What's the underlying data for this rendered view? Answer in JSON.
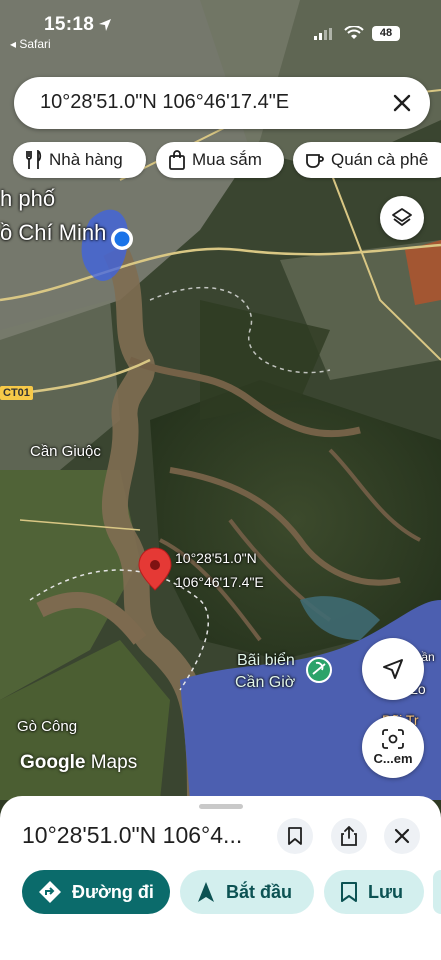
{
  "status_bar": {
    "time": "15:18",
    "back_app": "◂ Safari",
    "battery": "48"
  },
  "search": {
    "value": "10°28'51.0\"N 106°46'17.4\"E"
  },
  "chips": [
    {
      "label": "Nhà hàng",
      "icon": "utensils-icon"
    },
    {
      "label": "Mua sắm",
      "icon": "shopping-bag-icon"
    },
    {
      "label": "Quán cà phê",
      "icon": "coffee-icon"
    }
  ],
  "map": {
    "labels": {
      "city_line1": "h phố",
      "city_line2": "ồ Chí Minh",
      "can_giuoc": "Cần Giuộc",
      "go_cong": "Gò Công",
      "beach_line1": "Bãi biển",
      "beach_line2": "Cần Giờ",
      "east_a": "Gần",
      "east_b": "Bãi Tr",
      "east_c": "Bãi Lo",
      "road_badge": "CT01"
    },
    "pin_label_lat": "10°28'51.0\"N",
    "pin_label_lng": "106°46'17.4\"E",
    "lens_label": "C...em",
    "google_brand": "Google",
    "google_product": "Maps",
    "colors": {
      "pin": "#e53935",
      "water": "#4c5fb0",
      "location_dot": "#1a73e8"
    }
  },
  "sheet": {
    "title": "10°28'51.0\"N 106°4...",
    "actions": [
      {
        "label": "Đường đi",
        "icon": "directions-icon"
      },
      {
        "label": "Bắt đầu",
        "icon": "navigation-arrow-icon"
      },
      {
        "label": "Lưu",
        "icon": "bookmark-icon"
      }
    ],
    "colors": {
      "primary": "#0b6b6b",
      "secondary": "#d3efee"
    }
  }
}
